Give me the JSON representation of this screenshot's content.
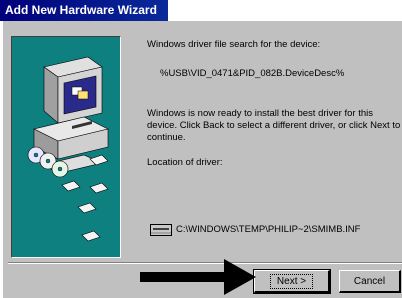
{
  "window": {
    "title": "Add New Hardware Wizard"
  },
  "content": {
    "heading": "Windows driver file search for the device:",
    "device_id": "%USB\\VID_0471&PID_082B.DeviceDesc%",
    "ready_message": "Windows is now ready to install the best driver for this device. Click Back to select a different driver, or click Next to continue.",
    "location_label": "Location of driver:",
    "driver_path": "C:\\WINDOWS\\TEMP\\PHILIP~2\\SMIMB.INF"
  },
  "buttons": {
    "next": "Next >",
    "cancel": "Cancel"
  },
  "colors": {
    "titlebar": "#00007a",
    "art_background": "#0f8080",
    "face": "#c0c0c0"
  },
  "icons": {
    "drive": "disk-drive-icon",
    "pointer": "arrow-annotation"
  }
}
